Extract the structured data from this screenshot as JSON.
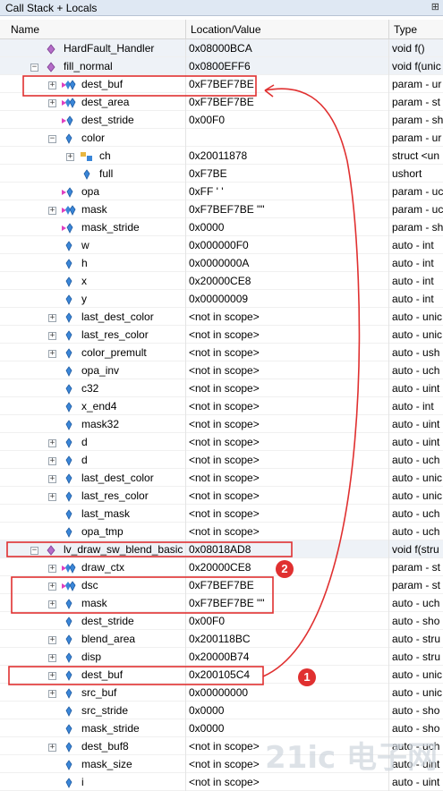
{
  "panel": {
    "title": "Call Stack + Locals",
    "pin_glyph": "⊞"
  },
  "columns": {
    "name": "Name",
    "location": "Location/Value",
    "type": "Type"
  },
  "rows": [
    {
      "name": "HardFault_Handler",
      "value": "0x08000BCA",
      "type": "void f()",
      "icon": "function-icon",
      "indent": 0,
      "expander": "",
      "frame": true
    },
    {
      "name": "fill_normal",
      "value": "0x0800EFF6",
      "type": "void f(unic",
      "icon": "function-icon",
      "indent": 0,
      "expander": "-",
      "frame": true
    },
    {
      "name": "dest_buf",
      "value": "0xF7BEF7BE",
      "type": "param - ur",
      "icon": "pointer-param-icon",
      "indent": 1,
      "expander": "+"
    },
    {
      "name": "dest_area",
      "value": "0xF7BEF7BE",
      "type": "param - st",
      "icon": "pointer-param-icon",
      "indent": 1,
      "expander": "+"
    },
    {
      "name": "dest_stride",
      "value": "0x00F0",
      "type": "param - sh",
      "icon": "param-icon",
      "indent": 1,
      "expander": ""
    },
    {
      "name": "color",
      "value": "",
      "type": "param - ur",
      "icon": "variable-icon",
      "indent": 1,
      "expander": "-"
    },
    {
      "name": "ch",
      "value": "0x20011878",
      "type": "struct <un",
      "icon": "struct-icon",
      "indent": 2,
      "expander": "+"
    },
    {
      "name": "full",
      "value": "0xF7BE",
      "type": "ushort",
      "icon": "variable-icon",
      "indent": 2,
      "expander": ""
    },
    {
      "name": "opa",
      "value": "0xFF '   '",
      "type": "param - uc",
      "icon": "param-icon",
      "indent": 1,
      "expander": ""
    },
    {
      "name": "mask",
      "value": "0xF7BEF7BE \"\"",
      "type": "param - uc",
      "icon": "pointer-param-icon",
      "indent": 1,
      "expander": "+"
    },
    {
      "name": "mask_stride",
      "value": "0x0000",
      "type": "param - sh",
      "icon": "param-icon",
      "indent": 1,
      "expander": ""
    },
    {
      "name": "w",
      "value": "0x000000F0",
      "type": "auto - int",
      "icon": "variable-icon",
      "indent": 1,
      "expander": ""
    },
    {
      "name": "h",
      "value": "0x0000000A",
      "type": "auto - int",
      "icon": "variable-icon",
      "indent": 1,
      "expander": ""
    },
    {
      "name": "x",
      "value": "0x20000CE8",
      "type": "auto - int",
      "icon": "variable-icon",
      "indent": 1,
      "expander": ""
    },
    {
      "name": "y",
      "value": "0x00000009",
      "type": "auto - int",
      "icon": "variable-icon",
      "indent": 1,
      "expander": ""
    },
    {
      "name": "last_dest_color",
      "value": "<not in scope>",
      "type": "auto - unic",
      "icon": "variable-icon",
      "indent": 1,
      "expander": "+"
    },
    {
      "name": "last_res_color",
      "value": "<not in scope>",
      "type": "auto - unic",
      "icon": "variable-icon",
      "indent": 1,
      "expander": "+"
    },
    {
      "name": "color_premult",
      "value": "<not in scope>",
      "type": "auto - ush",
      "icon": "variable-icon",
      "indent": 1,
      "expander": "+"
    },
    {
      "name": "opa_inv",
      "value": "<not in scope>",
      "type": "auto - uch",
      "icon": "variable-icon",
      "indent": 1,
      "expander": ""
    },
    {
      "name": "c32",
      "value": "<not in scope>",
      "type": "auto - uint",
      "icon": "variable-icon",
      "indent": 1,
      "expander": ""
    },
    {
      "name": "x_end4",
      "value": "<not in scope>",
      "type": "auto - int",
      "icon": "variable-icon",
      "indent": 1,
      "expander": ""
    },
    {
      "name": "mask32",
      "value": "<not in scope>",
      "type": "auto - uint",
      "icon": "variable-icon",
      "indent": 1,
      "expander": ""
    },
    {
      "name": "d",
      "value": "<not in scope>",
      "type": "auto - uint",
      "icon": "variable-icon",
      "indent": 1,
      "expander": "+"
    },
    {
      "name": "d",
      "value": "<not in scope>",
      "type": "auto - uch",
      "icon": "variable-icon",
      "indent": 1,
      "expander": "+"
    },
    {
      "name": "last_dest_color",
      "value": "<not in scope>",
      "type": "auto - unic",
      "icon": "variable-icon",
      "indent": 1,
      "expander": "+"
    },
    {
      "name": "last_res_color",
      "value": "<not in scope>",
      "type": "auto - unic",
      "icon": "variable-icon",
      "indent": 1,
      "expander": "+"
    },
    {
      "name": "last_mask",
      "value": "<not in scope>",
      "type": "auto - uch",
      "icon": "variable-icon",
      "indent": 1,
      "expander": ""
    },
    {
      "name": "opa_tmp",
      "value": "<not in scope>",
      "type": "auto - uch",
      "icon": "variable-icon",
      "indent": 1,
      "expander": ""
    },
    {
      "name": "lv_draw_sw_blend_basic",
      "value": "0x08018AD8",
      "type": "void f(stru",
      "icon": "function-icon",
      "indent": 0,
      "expander": "-",
      "frame": true
    },
    {
      "name": "draw_ctx",
      "value": "0x20000CE8",
      "type": "param - st",
      "icon": "pointer-param-icon",
      "indent": 1,
      "expander": "+"
    },
    {
      "name": "dsc",
      "value": "0xF7BEF7BE",
      "type": "param - st",
      "icon": "pointer-param-icon",
      "indent": 1,
      "expander": "+"
    },
    {
      "name": "mask",
      "value": "0xF7BEF7BE \"\"",
      "type": "auto - uch",
      "icon": "variable-icon",
      "indent": 1,
      "expander": "+"
    },
    {
      "name": "dest_stride",
      "value": "0x00F0",
      "type": "auto - sho",
      "icon": "variable-icon",
      "indent": 1,
      "expander": ""
    },
    {
      "name": "blend_area",
      "value": "0x200118BC",
      "type": "auto - stru",
      "icon": "variable-icon",
      "indent": 1,
      "expander": "+"
    },
    {
      "name": "disp",
      "value": "0x20000B74",
      "type": "auto - stru",
      "icon": "variable-icon",
      "indent": 1,
      "expander": "+"
    },
    {
      "name": "dest_buf",
      "value": "0x200105C4",
      "type": "auto - unic",
      "icon": "variable-icon",
      "indent": 1,
      "expander": "+"
    },
    {
      "name": "src_buf",
      "value": "0x00000000",
      "type": "auto - unic",
      "icon": "variable-icon",
      "indent": 1,
      "expander": "+"
    },
    {
      "name": "src_stride",
      "value": "0x0000",
      "type": "auto - sho",
      "icon": "variable-icon",
      "indent": 1,
      "expander": ""
    },
    {
      "name": "mask_stride",
      "value": "0x0000",
      "type": "auto - sho",
      "icon": "variable-icon",
      "indent": 1,
      "expander": ""
    },
    {
      "name": "dest_buf8",
      "value": "<not in scope>",
      "type": "auto - uch",
      "icon": "variable-icon",
      "indent": 1,
      "expander": "+"
    },
    {
      "name": "mask_size",
      "value": "<not in scope>",
      "type": "auto - uint",
      "icon": "variable-icon",
      "indent": 1,
      "expander": ""
    },
    {
      "name": "i",
      "value": "<not in scope>",
      "type": "auto - uint",
      "icon": "variable-icon",
      "indent": 1,
      "expander": ""
    }
  ],
  "annotations": {
    "marker1": "1",
    "marker2": "2",
    "accent": "#e03030"
  },
  "watermark": "21ic 电子网"
}
